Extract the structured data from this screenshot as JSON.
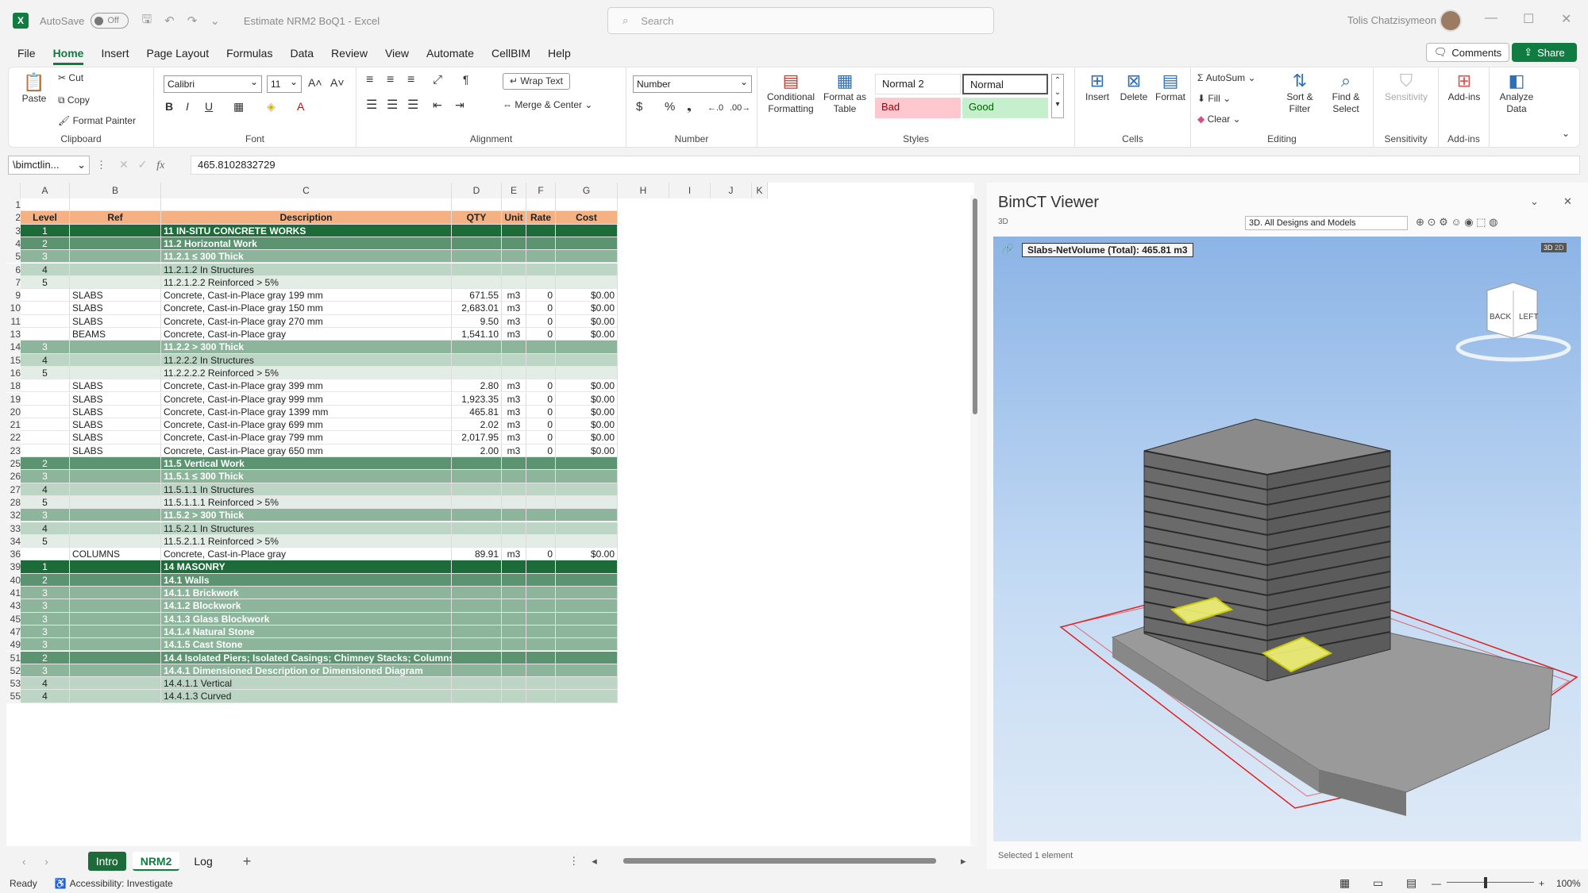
{
  "titlebar": {
    "autosave_label": "AutoSave",
    "autosave_state": "Off",
    "doc_title": "Estimate NRM2 BoQ1 - Excel",
    "search_placeholder": "Search",
    "user_name": "Tolis Chatzisymeon"
  },
  "menu": {
    "items": [
      "File",
      "Home",
      "Insert",
      "Page Layout",
      "Formulas",
      "Data",
      "Review",
      "View",
      "Automate",
      "CellBIM",
      "Help"
    ],
    "active": "Home",
    "comments_label": "Comments",
    "share_label": "Share"
  },
  "ribbon": {
    "clipboard": {
      "paste": "Paste",
      "cut": "Cut",
      "copy": "Copy",
      "format_painter": "Format Painter",
      "group": "Clipboard"
    },
    "font": {
      "family": "Calibri",
      "size": "11",
      "group": "Font"
    },
    "alignment": {
      "wrap_text": "Wrap Text",
      "merge_center": "Merge & Center",
      "group": "Alignment"
    },
    "number": {
      "format": "Number",
      "group": "Number"
    },
    "styles": {
      "conditional": "Conditional Formatting",
      "format_table": "Format as Table",
      "normal2": "Normal 2",
      "normal": "Normal",
      "bad": "Bad",
      "good": "Good",
      "group": "Styles"
    },
    "cells": {
      "insert": "Insert",
      "delete": "Delete",
      "format": "Format",
      "group": "Cells"
    },
    "editing": {
      "autosum": "AutoSum",
      "fill": "Fill",
      "clear": "Clear",
      "sort_filter": "Sort & Filter",
      "find_select": "Find & Select",
      "group": "Editing"
    },
    "sensitivity": {
      "label": "Sensitivity",
      "group": "Sensitivity"
    },
    "addins": {
      "label": "Add-ins",
      "group": "Add-ins"
    },
    "analyze": {
      "label": "Analyze Data"
    }
  },
  "formula_bar": {
    "name_box": "\\bimctlin...",
    "fx": "fx",
    "value": "465.8102832729"
  },
  "columns": [
    "A",
    "B",
    "C",
    "D",
    "E",
    "F",
    "G",
    "H",
    "I",
    "J",
    "K"
  ],
  "header_row": {
    "rownum": "2",
    "level": "Level",
    "ref": "Ref",
    "description": "Description",
    "qty": "QTY",
    "unit": "Unit",
    "rate": "Rate",
    "cost": "Cost"
  },
  "rows": [
    {
      "n": "1",
      "style": "blank",
      "level": "",
      "ref": "",
      "desc": "",
      "qty": "",
      "unit": "",
      "rate": "",
      "cost": ""
    },
    {
      "n": "3",
      "style": "l1",
      "level": "1",
      "ref": "",
      "desc": "11 IN-SITU CONCRETE WORKS",
      "qty": "",
      "unit": "",
      "rate": "",
      "cost": ""
    },
    {
      "n": "4",
      "style": "l2",
      "level": "2",
      "ref": "",
      "desc": "11.2 Horizontal Work",
      "qty": "",
      "unit": "",
      "rate": "",
      "cost": ""
    },
    {
      "n": "5",
      "style": "l3",
      "level": "3",
      "ref": "",
      "desc": "11.2.1 ≤ 300 Thick",
      "qty": "",
      "unit": "",
      "rate": "",
      "cost": ""
    },
    {
      "n": "6",
      "style": "l4",
      "level": "4",
      "ref": "",
      "desc": "11.2.1.2 In Structures",
      "qty": "",
      "unit": "",
      "rate": "",
      "cost": ""
    },
    {
      "n": "7",
      "style": "l5",
      "level": "5",
      "ref": "",
      "desc": "11.2.1.2.2 Reinforced > 5%",
      "qty": "",
      "unit": "",
      "rate": "",
      "cost": ""
    },
    {
      "n": "9",
      "style": "item",
      "level": "",
      "ref": "SLABS",
      "desc": "Concrete, Cast-in-Place gray 199 mm",
      "qty": "671.55",
      "unit": "m3",
      "rate": "0",
      "cost": "$0.00"
    },
    {
      "n": "10",
      "style": "item",
      "level": "",
      "ref": "SLABS",
      "desc": "Concrete, Cast-in-Place gray 150 mm",
      "qty": "2,683.01",
      "unit": "m3",
      "rate": "0",
      "cost": "$0.00"
    },
    {
      "n": "11",
      "style": "item",
      "level": "",
      "ref": "SLABS",
      "desc": "Concrete, Cast-in-Place gray 270 mm",
      "qty": "9.50",
      "unit": "m3",
      "rate": "0",
      "cost": "$0.00"
    },
    {
      "n": "13",
      "style": "item",
      "level": "",
      "ref": "BEAMS",
      "desc": "Concrete, Cast-in-Place gray",
      "qty": "1,541.10",
      "unit": "m3",
      "rate": "0",
      "cost": "$0.00"
    },
    {
      "n": "14",
      "style": "l3",
      "level": "3",
      "ref": "",
      "desc": "11.2.2 > 300 Thick",
      "qty": "",
      "unit": "",
      "rate": "",
      "cost": ""
    },
    {
      "n": "15",
      "style": "l4",
      "level": "4",
      "ref": "",
      "desc": "11.2.2.2 In Structures",
      "qty": "",
      "unit": "",
      "rate": "",
      "cost": ""
    },
    {
      "n": "16",
      "style": "l5",
      "level": "5",
      "ref": "",
      "desc": "11.2.2.2.2 Reinforced > 5%",
      "qty": "",
      "unit": "",
      "rate": "",
      "cost": ""
    },
    {
      "n": "18",
      "style": "item",
      "level": "",
      "ref": "SLABS",
      "desc": "Concrete, Cast-in-Place gray 399 mm",
      "qty": "2.80",
      "unit": "m3",
      "rate": "0",
      "cost": "$0.00"
    },
    {
      "n": "19",
      "style": "item",
      "level": "",
      "ref": "SLABS",
      "desc": "Concrete, Cast-in-Place gray 999 mm",
      "qty": "1,923.35",
      "unit": "m3",
      "rate": "0",
      "cost": "$0.00"
    },
    {
      "n": "20",
      "style": "item",
      "level": "",
      "ref": "SLABS",
      "desc": "Concrete, Cast-in-Place gray 1399 mm",
      "qty": "465.81",
      "unit": "m3",
      "rate": "0",
      "cost": "$0.00"
    },
    {
      "n": "21",
      "style": "item",
      "level": "",
      "ref": "SLABS",
      "desc": "Concrete, Cast-in-Place gray 699 mm",
      "qty": "2.02",
      "unit": "m3",
      "rate": "0",
      "cost": "$0.00"
    },
    {
      "n": "22",
      "style": "item",
      "level": "",
      "ref": "SLABS",
      "desc": "Concrete, Cast-in-Place gray 799 mm",
      "qty": "2,017.95",
      "unit": "m3",
      "rate": "0",
      "cost": "$0.00"
    },
    {
      "n": "23",
      "style": "item",
      "level": "",
      "ref": "SLABS",
      "desc": "Concrete, Cast-in-Place gray 650 mm",
      "qty": "2.00",
      "unit": "m3",
      "rate": "0",
      "cost": "$0.00"
    },
    {
      "n": "25",
      "style": "l2",
      "level": "2",
      "ref": "",
      "desc": "11.5 Vertical Work",
      "qty": "",
      "unit": "",
      "rate": "",
      "cost": ""
    },
    {
      "n": "26",
      "style": "l3",
      "level": "3",
      "ref": "",
      "desc": "11.5.1 ≤ 300 Thick",
      "qty": "",
      "unit": "",
      "rate": "",
      "cost": ""
    },
    {
      "n": "27",
      "style": "l4",
      "level": "4",
      "ref": "",
      "desc": "11.5.1.1 In Structures",
      "qty": "",
      "unit": "",
      "rate": "",
      "cost": ""
    },
    {
      "n": "28",
      "style": "l5",
      "level": "5",
      "ref": "",
      "desc": "11.5.1.1.1 Reinforced > 5%",
      "qty": "",
      "unit": "",
      "rate": "",
      "cost": ""
    },
    {
      "n": "32",
      "style": "l3",
      "level": "3",
      "ref": "",
      "desc": "11.5.2 > 300 Thick",
      "qty": "",
      "unit": "",
      "rate": "",
      "cost": ""
    },
    {
      "n": "33",
      "style": "l4",
      "level": "4",
      "ref": "",
      "desc": "11.5.2.1 In Structures",
      "qty": "",
      "unit": "",
      "rate": "",
      "cost": ""
    },
    {
      "n": "34",
      "style": "l5",
      "level": "5",
      "ref": "",
      "desc": "11.5.2.1.1 Reinforced > 5%",
      "qty": "",
      "unit": "",
      "rate": "",
      "cost": ""
    },
    {
      "n": "36",
      "style": "item",
      "level": "",
      "ref": "COLUMNS",
      "desc": "Concrete, Cast-in-Place gray",
      "qty": "89.91",
      "unit": "m3",
      "rate": "0",
      "cost": "$0.00"
    },
    {
      "n": "39",
      "style": "l1",
      "level": "1",
      "ref": "",
      "desc": "14 MASONRY",
      "qty": "",
      "unit": "",
      "rate": "",
      "cost": ""
    },
    {
      "n": "40",
      "style": "l2",
      "level": "2",
      "ref": "",
      "desc": "14.1 Walls",
      "qty": "",
      "unit": "",
      "rate": "",
      "cost": ""
    },
    {
      "n": "41",
      "style": "l3",
      "level": "3",
      "ref": "",
      "desc": "14.1.1 Brickwork",
      "qty": "",
      "unit": "",
      "rate": "",
      "cost": ""
    },
    {
      "n": "43",
      "style": "l3",
      "level": "3",
      "ref": "",
      "desc": "14.1.2 Blockwork",
      "qty": "",
      "unit": "",
      "rate": "",
      "cost": ""
    },
    {
      "n": "45",
      "style": "l3",
      "level": "3",
      "ref": "",
      "desc": "14.1.3 Glass Blockwork",
      "qty": "",
      "unit": "",
      "rate": "",
      "cost": ""
    },
    {
      "n": "47",
      "style": "l3",
      "level": "3",
      "ref": "",
      "desc": "14.1.4 Natural Stone",
      "qty": "",
      "unit": "",
      "rate": "",
      "cost": ""
    },
    {
      "n": "49",
      "style": "l3",
      "level": "3",
      "ref": "",
      "desc": "14.1.5 Cast Stone",
      "qty": "",
      "unit": "",
      "rate": "",
      "cost": ""
    },
    {
      "n": "51",
      "style": "l2",
      "level": "2",
      "ref": "",
      "desc": "14.4  Isolated Piers; Isolated Casings; Chimney Stacks; Columns",
      "qty": "",
      "unit": "",
      "rate": "",
      "cost": ""
    },
    {
      "n": "52",
      "style": "l3",
      "level": "3",
      "ref": "",
      "desc": "14.4.1 Dimensioned Description or Dimensioned Diagram",
      "qty": "",
      "unit": "",
      "rate": "",
      "cost": ""
    },
    {
      "n": "53",
      "style": "l4",
      "level": "4",
      "ref": "",
      "desc": "14.4.1.1 Vertical",
      "qty": "",
      "unit": "",
      "rate": "",
      "cost": ""
    },
    {
      "n": "55",
      "style": "l4",
      "level": "4",
      "ref": "",
      "desc": "14.4.1.3 Curved",
      "qty": "",
      "unit": "",
      "rate": "",
      "cost": ""
    }
  ],
  "sheet_tabs": [
    {
      "label": "Intro",
      "kind": "intro"
    },
    {
      "label": "NRM2",
      "kind": "active"
    },
    {
      "label": "Log",
      "kind": "normal"
    }
  ],
  "status": {
    "ready": "Ready",
    "accessibility": "Accessibility: Investigate",
    "zoom": "100%"
  },
  "viewer": {
    "title": "BimCT Viewer",
    "mode": "3D",
    "combo": "3D. All Designs and Models",
    "label": "Slabs-NetVolume (Total): 465.81 m3",
    "cube_back": "BACK",
    "cube_left": "LEFT",
    "badge_3d": "3D",
    "badge_2d": "2D",
    "status": "Selected 1 element"
  },
  "colors": {
    "accent": "#107c41",
    "header_fill": "#f4b183",
    "level1": "#1e6b3a",
    "level2": "#5c9472",
    "level3": "#8db59c",
    "level4": "#bcd5c4",
    "level5": "#e3ede6"
  }
}
